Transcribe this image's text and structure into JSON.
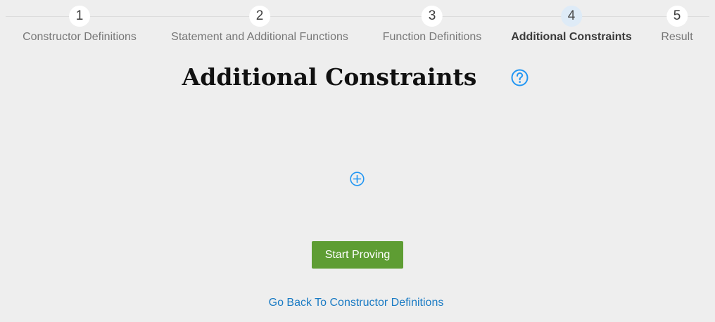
{
  "stepper": {
    "steps": [
      {
        "number": "1",
        "label": "Constructor Definitions"
      },
      {
        "number": "2",
        "label": "Statement and Additional Functions"
      },
      {
        "number": "3",
        "label": "Function Definitions"
      },
      {
        "number": "4",
        "label": "Additional Constraints",
        "active": true
      },
      {
        "number": "5",
        "label": "Result"
      }
    ]
  },
  "main": {
    "title": "Additional Constraints",
    "help_icon": "question-circle-icon",
    "add_icon": "plus-circle-icon",
    "start_button_label": "Start Proving",
    "back_link_label": "Go Back To Constructor Definitions"
  },
  "colors": {
    "background": "#eeeeee",
    "accent_blue": "#2196f3",
    "link_blue": "#1a7bc4",
    "button_green": "#5e9d33",
    "active_step_bg": "#deebf7"
  }
}
